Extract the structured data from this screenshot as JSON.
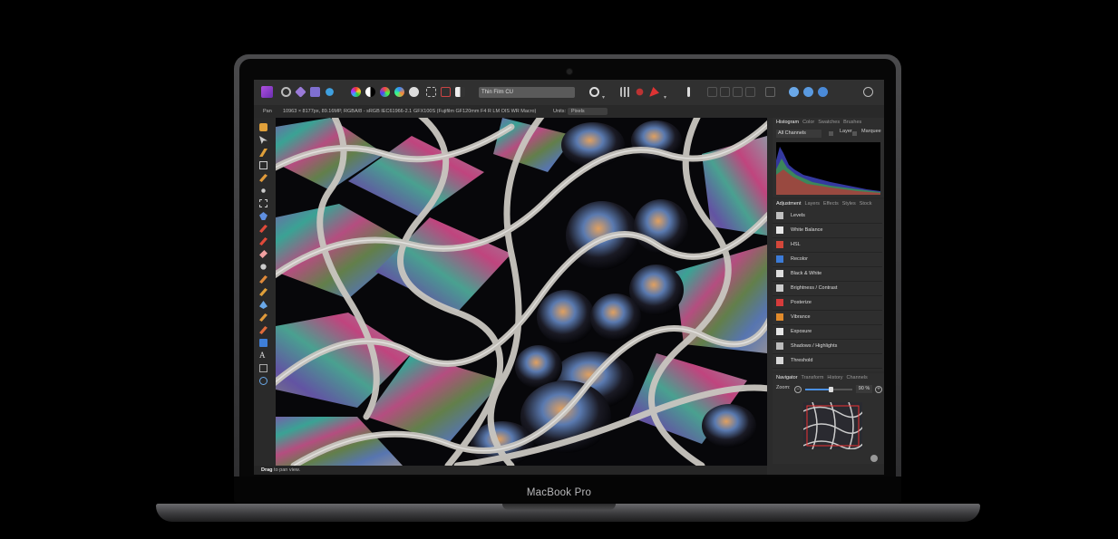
{
  "app": {
    "document_name": "Thin Film CU",
    "context": {
      "tool": "Pan",
      "image_info": "10963 × 8177px, 89.16MP, RGBA/8 - sRGB IEC61966-2.1",
      "camera": "GFX100S (Fujifilm GF120mm F4 R LM OIS WR Macro)",
      "units_label": "Units:",
      "units_value": "Pixels"
    },
    "histogram_panel": {
      "tabs": [
        "Histogram",
        "Color",
        "Swatches",
        "Brushes"
      ],
      "active_tab": "Histogram",
      "channel": "All Channels",
      "layer_label": "Layer",
      "marquee_label": "Marquee"
    },
    "adjustment_panel": {
      "tabs": [
        "Adjustment",
        "Layers",
        "Effects",
        "Styles",
        "Stock"
      ],
      "active_tab": "Adjustment",
      "items": [
        {
          "label": "Levels",
          "icon": "levels-icon",
          "color": "#bfbfbf"
        },
        {
          "label": "White Balance",
          "icon": "white-balance-icon",
          "color": "#e7e7e7"
        },
        {
          "label": "HSL",
          "icon": "hsl-icon",
          "color": "#d4473a"
        },
        {
          "label": "Recolor",
          "icon": "recolor-icon",
          "color": "#3c7bd6"
        },
        {
          "label": "Black & White",
          "icon": "black-white-icon",
          "color": "#dddddd"
        },
        {
          "label": "Brightness / Contrast",
          "icon": "brightness-contrast-icon",
          "color": "#cccccc"
        },
        {
          "label": "Posterize",
          "icon": "posterize-icon",
          "color": "#d63b3b"
        },
        {
          "label": "Vibrance",
          "icon": "vibrance-icon",
          "color": "#e08a2b"
        },
        {
          "label": "Exposure",
          "icon": "exposure-icon",
          "color": "#e6e6e6"
        },
        {
          "label": "Shadows / Highlights",
          "icon": "shadows-highlights-icon",
          "color": "#bbbbbb"
        },
        {
          "label": "Threshold",
          "icon": "threshold-icon",
          "color": "#d8d8d8"
        }
      ]
    },
    "navigator_panel": {
      "tabs": [
        "Navigator",
        "Transform",
        "History",
        "Channels"
      ],
      "active_tab": "Navigator",
      "zoom_label": "Zoom:",
      "zoom_value": "90 %"
    },
    "status": {
      "action": "Drag",
      "hint": " to pan view."
    }
  },
  "device": {
    "brand": "MacBook Pro"
  }
}
